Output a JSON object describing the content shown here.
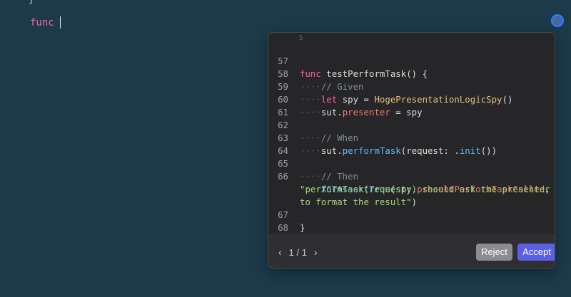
{
  "editor": {
    "prev_line": "}",
    "current_text": "func"
  },
  "popup": {
    "top_number": "5",
    "lines": [
      {
        "n": "57"
      },
      {
        "n": "58"
      },
      {
        "n": "59"
      },
      {
        "n": "60"
      },
      {
        "n": "61"
      },
      {
        "n": "62"
      },
      {
        "n": "63"
      },
      {
        "n": "64"
      },
      {
        "n": "65"
      },
      {
        "n": "66"
      },
      {
        "n": ""
      },
      {
        "n": ""
      },
      {
        "n": "67"
      },
      {
        "n": "68"
      }
    ],
    "code": {
      "l57_kw": "func",
      "l57_rest": " testPerformTask() {",
      "l58": "// Given",
      "l59_kw": "let",
      "l59_mid": " spy = ",
      "l59_type": "HogePresentationLogicSpy",
      "l59_end": "()",
      "l60_a": "sut.",
      "l60_prop": "presenter",
      "l60_end": " = spy",
      "l62": "// When",
      "l63_a": "sut.",
      "l63_fn": "performTask",
      "l63_mid": "(request: .",
      "l63_fn2": "init",
      "l63_end": "())",
      "l65": "// Then",
      "l66_fn": "XCTAssertTrue",
      "l66_mid": "(spy.",
      "l66_prop": "presentPerformTaskCalled",
      "l66_end": ",",
      "l66_str1": "\"performTask(request:) should ask the presenter",
      "l66_str2": "to format the result\"",
      "l66_close": ")",
      "l67": "}"
    },
    "nav_prev": "‹",
    "nav_counter": "1 / 1",
    "nav_next": "›",
    "reject_label": "Reject",
    "accept_label": "Accept"
  }
}
